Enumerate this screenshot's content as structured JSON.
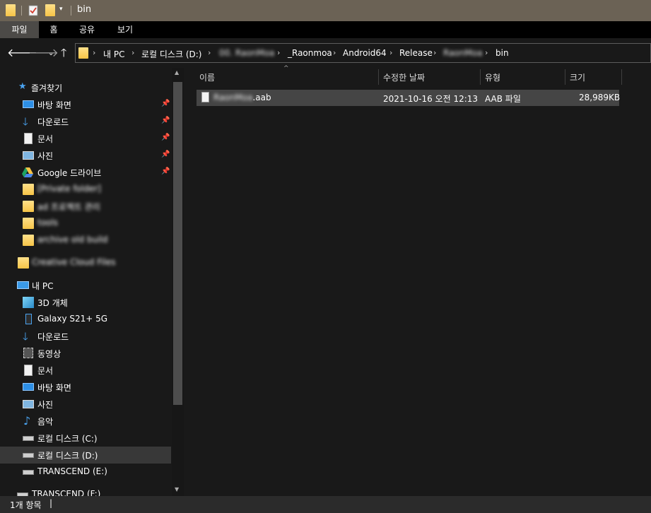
{
  "window": {
    "title": "bin"
  },
  "ribbon": {
    "tabs": [
      "파일",
      "홈",
      "공유",
      "보기"
    ],
    "active_tab": "파일"
  },
  "address": {
    "crumbs": [
      {
        "text": "내 PC",
        "obscured": false
      },
      {
        "text": "로컬 디스크 (D:)",
        "obscured": false
      },
      {
        "text": "00. RaonMoa",
        "obscured": true
      },
      {
        "text": "_Raonmoa",
        "obscured": false
      },
      {
        "text": "Android64",
        "obscured": false
      },
      {
        "text": "Release",
        "obscured": false
      },
      {
        "text": "RaonMoa",
        "obscured": true
      },
      {
        "text": "bin",
        "obscured": false
      }
    ]
  },
  "quick_access": {
    "header": "즐겨찾기",
    "items": [
      {
        "label": "바탕 화면",
        "icon": "desktop-icon",
        "pinned": true
      },
      {
        "label": "다운로드",
        "icon": "download-icon",
        "pinned": true
      },
      {
        "label": "문서",
        "icon": "document-icon",
        "pinned": true
      },
      {
        "label": "사진",
        "icon": "pictures-icon",
        "pinned": true
      },
      {
        "label": "Google 드라이브",
        "icon": "google-drive-icon",
        "pinned": true
      },
      {
        "label": "[Private folder]",
        "icon": "folder-icon",
        "obscured": true
      },
      {
        "label": "ad 프로젝트 관리",
        "icon": "folder-icon",
        "obscured": true
      },
      {
        "label": "tools",
        "icon": "folder-icon",
        "obscured": true
      },
      {
        "label": "archive old build",
        "icon": "folder-icon",
        "obscured": true
      }
    ]
  },
  "creative_cloud": {
    "label": "Creative Cloud Files",
    "obscured": true
  },
  "this_pc": {
    "header": "내 PC",
    "items": [
      {
        "label": "3D 개체",
        "icon": "3d-objects-icon"
      },
      {
        "label": "Galaxy S21+ 5G",
        "icon": "phone-icon"
      },
      {
        "label": "다운로드",
        "icon": "download-icon"
      },
      {
        "label": "동영상",
        "icon": "video-icon"
      },
      {
        "label": "문서",
        "icon": "document-icon"
      },
      {
        "label": "바탕 화면",
        "icon": "desktop-icon"
      },
      {
        "label": "사진",
        "icon": "pictures-icon"
      },
      {
        "label": "음악",
        "icon": "music-icon"
      },
      {
        "label": "로컬 디스크 (C:)",
        "icon": "system-drive-icon"
      },
      {
        "label": "로컬 디스크 (D:)",
        "icon": "drive-icon",
        "selected": true
      },
      {
        "label": "TRANSCEND (E:)",
        "icon": "drive-icon"
      },
      {
        "label": "TRANSCEND (F:)",
        "icon": "drive-icon"
      }
    ]
  },
  "columns": {
    "name": "이름",
    "modified": "수정한 날짜",
    "type": "유형",
    "size": "크기"
  },
  "files": [
    {
      "name_obscured": "RaonMoa",
      "name_ext": ".aab",
      "modified": "2021-10-16 오전 12:13",
      "type": "AAB 파일",
      "size": "28,989KB"
    }
  ],
  "status": {
    "text": "1개 항목",
    "cursor": "|"
  },
  "colors": {
    "titlebar": "#6b6255",
    "ribbon": "#000000",
    "background": "#191919",
    "selected_row": "#454545",
    "accent_blue": "#4aa3f0",
    "folder_yellow": "#f6c447"
  }
}
